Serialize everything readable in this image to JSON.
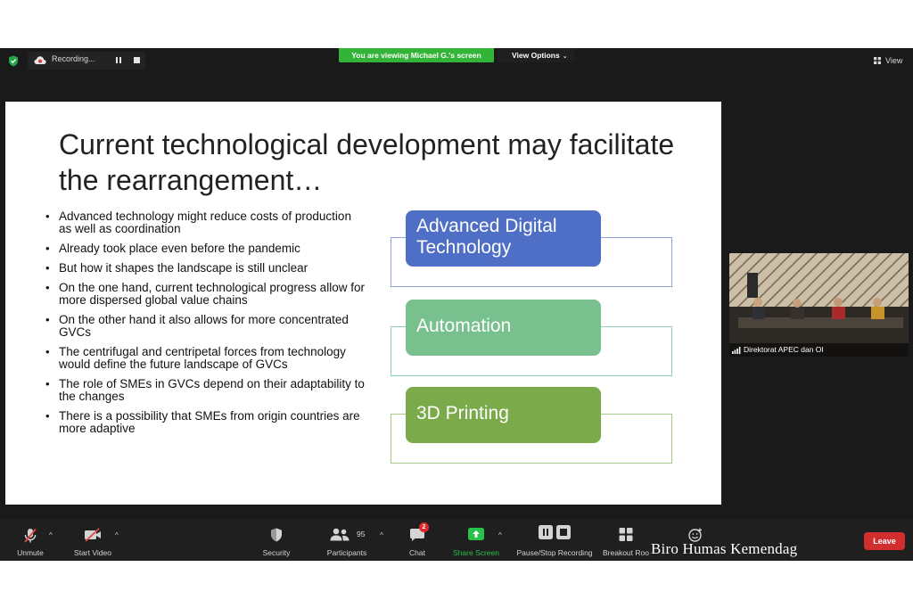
{
  "top_bar": {
    "recording_label": "Recording...",
    "viewing_banner": "You are viewing Michael G.'s screen",
    "view_options_label": "View Options",
    "view_label": "View"
  },
  "slide": {
    "title": "Current technological development may facilitate the rearrangement…",
    "bullets": [
      "Advanced technology might reduce costs of production as well as coordination",
      "Already took place even before the pandemic",
      "But how it shapes the landscape is still unclear",
      "On the one hand, current technological progress allow for more dispersed global value chains",
      "On the other hand it also allows for more concentrated GVCs",
      "The centrifugal and centripetal forces from technology would define the future landscape of GVCs",
      "The role of SMEs in GVCs depend on their adaptability to the changes",
      "There is a possibility that SMEs from origin countries are more adaptive"
    ],
    "boxes": [
      "Advanced Digital Technology",
      "Automation",
      "3D Printing"
    ],
    "box_colors": [
      "#4f6fc6",
      "#79c08f",
      "#7aaa4a"
    ]
  },
  "participant": {
    "name": "Direktorat APEC dan OI"
  },
  "toolbar": {
    "unmute": "Unmute",
    "start_video": "Start Video",
    "security": "Security",
    "participants": "Participants",
    "participants_count": "95",
    "chat": "Chat",
    "chat_badge": "2",
    "share_screen": "Share Screen",
    "pause_stop_recording": "Pause/Stop Recording",
    "breakout_rooms": "Breakout Roo",
    "leave": "Leave"
  },
  "watermark": "Biro Humas Kemendag",
  "colors": {
    "banner_green": "#33b338",
    "share_green": "#26c24a",
    "leave_red": "#d12f2f",
    "badge_red": "#e02828"
  }
}
